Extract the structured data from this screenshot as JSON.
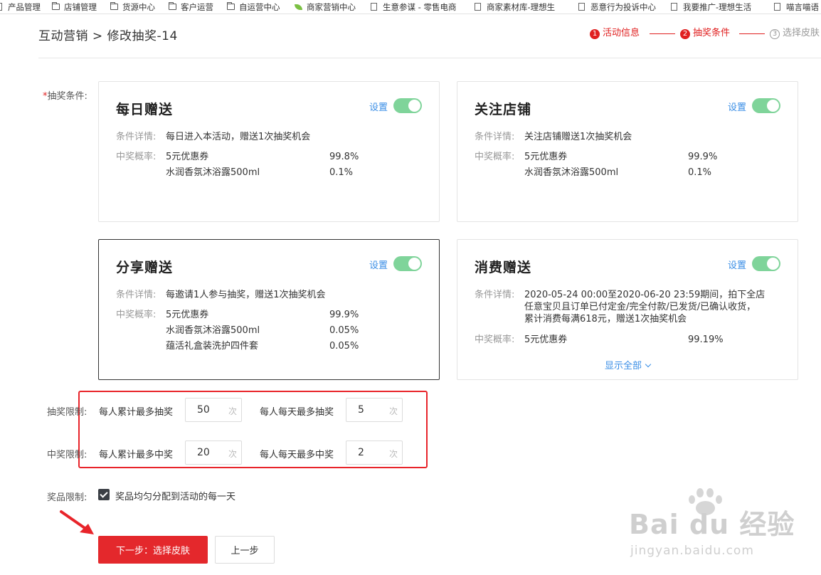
{
  "bookmarks": [
    {
      "label": "产品管理",
      "icon": "page-icon"
    },
    {
      "label": "店铺管理",
      "icon": "folder-icon"
    },
    {
      "label": "货源中心",
      "icon": "folder-icon"
    },
    {
      "label": "客户运营",
      "icon": "folder-icon"
    },
    {
      "label": "自运营中心",
      "icon": "folder-icon"
    },
    {
      "label": "商家营销中心",
      "icon": "leaf-icon"
    },
    {
      "label": "生意参谋 - 零售电商",
      "icon": "page-icon"
    },
    {
      "label": "商家素材库-理想生",
      "icon": "page-icon"
    },
    {
      "label": "恶意行为投诉中心",
      "icon": "page-icon"
    },
    {
      "label": "我要推广-理想生活",
      "icon": "page-icon"
    },
    {
      "label": "喵言喵语",
      "icon": "page-icon"
    }
  ],
  "header": {
    "breadcrumb": "互动营销 > 修改抽奖-14",
    "steps": [
      {
        "num": "1",
        "label": "活动信息",
        "state": "done"
      },
      {
        "num": "2",
        "label": "抽奖条件",
        "state": "done"
      },
      {
        "num": "3",
        "label": "选择皮肤",
        "state": "future"
      }
    ]
  },
  "conditions": {
    "label_required": "*",
    "label": "抽奖条件:",
    "detail_key": "条件详情:",
    "prob_key": "中奖概率:",
    "set_label": "设置",
    "cards": [
      {
        "title": "每日赠送",
        "enabled": true,
        "detail": "每日进入本活动，赠送1次抽奖机会",
        "prizes": [
          {
            "name": "5元优惠券",
            "pct": "99.8%"
          },
          {
            "name": "水润香氛沐浴露500ml",
            "pct": "0.1%"
          }
        ]
      },
      {
        "title": "关注店铺",
        "enabled": true,
        "detail": "关注店铺赠送1次抽奖机会",
        "prizes": [
          {
            "name": "5元优惠券",
            "pct": "99.9%"
          },
          {
            "name": "水润香氛沐浴露500ml",
            "pct": "0.1%"
          }
        ]
      },
      {
        "title": "分享赠送",
        "enabled": true,
        "detail": "每邀请1人参与抽奖，赠送1次抽奖机会",
        "prizes": [
          {
            "name": "5元优惠券",
            "pct": "99.9%"
          },
          {
            "name": "水润香氛沐浴露500ml",
            "pct": "0.05%"
          },
          {
            "name": "蕴活礼盒装洗护四件套",
            "pct": "0.05%"
          }
        ]
      },
      {
        "title": "消费赠送",
        "enabled": true,
        "detail_lines": [
          "2020-05-24 00:00至2020-06-20 23:59期间，拍下全店",
          "任意宝贝且订单已付定金/完全付款/已发货/已确认收货，",
          "累计消费每满618元，赠送1次抽奖机会"
        ],
        "prizes": [
          {
            "name": "5元优惠券",
            "pct": "99.19%"
          }
        ],
        "show_all": "显示全部"
      }
    ]
  },
  "limits": {
    "draw_label": "抽奖限制:",
    "win_label": "中奖限制:",
    "unit": "次",
    "draw_total_label": "每人累计最多抽奖",
    "draw_total_value": "50",
    "draw_daily_label": "每人每天最多抽奖",
    "draw_daily_value": "5",
    "win_total_label": "每人累计最多中奖",
    "win_total_value": "20",
    "win_daily_label": "每人每天最多中奖",
    "win_daily_value": "2"
  },
  "prize_limit": {
    "label": "奖品限制:",
    "checked": true,
    "checkbox_label": "奖品均匀分配到活动的每一天"
  },
  "buttons": {
    "next": "下一步：选择皮肤",
    "prev": "上一步"
  },
  "watermark": {
    "brand": "Bai du 经验",
    "url": "jingyan.baidu.com"
  },
  "colors": {
    "accent_red": "#e4282c",
    "link_blue": "#3a8ee6",
    "toggle_green": "#7fd49a"
  }
}
